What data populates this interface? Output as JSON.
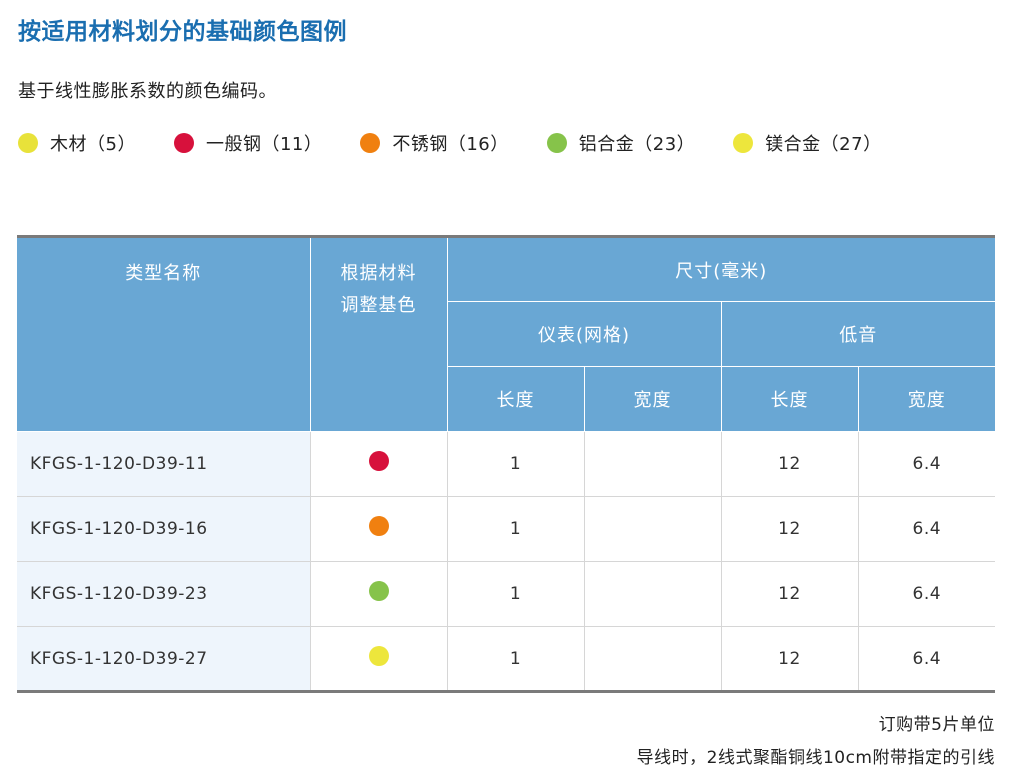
{
  "title": "按适用材料划分的基础颜色图例",
  "subtitle": "基于线性膨胀系数的颜色编码。",
  "legend": [
    {
      "label": "木材（5）",
      "color": "#e8e23a"
    },
    {
      "label": "一般钢（11）",
      "color": "#d7113c"
    },
    {
      "label": "不锈钢（16）",
      "color": "#f08010"
    },
    {
      "label": "铝合金（23）",
      "color": "#86c34a"
    },
    {
      "label": "镁合金（27）",
      "color": "#ede63c"
    }
  ],
  "table": {
    "headers": {
      "type_name": "类型名称",
      "base_color_line1": "根据材料",
      "base_color_line2": "调整基色",
      "size": "尺寸(毫米)",
      "gauge": "仪表(网格)",
      "bass": "低音",
      "length": "长度",
      "width": "宽度"
    },
    "rows": [
      {
        "name": "KFGS-1-120-D39-11",
        "color": "#d7113c",
        "gauge_length": "1",
        "gauge_width": "",
        "bass_length": "12",
        "bass_width": "6.4"
      },
      {
        "name": "KFGS-1-120-D39-16",
        "color": "#f08010",
        "gauge_length": "1",
        "gauge_width": "",
        "bass_length": "12",
        "bass_width": "6.4"
      },
      {
        "name": "KFGS-1-120-D39-23",
        "color": "#86c34a",
        "gauge_length": "1",
        "gauge_width": "",
        "bass_length": "12",
        "bass_width": "6.4"
      },
      {
        "name": "KFGS-1-120-D39-27",
        "color": "#ede63c",
        "gauge_length": "1",
        "gauge_width": "",
        "bass_length": "12",
        "bass_width": "6.4"
      }
    ]
  },
  "notes": {
    "line1": "订购带5片单位",
    "line2": "导线时，2线式聚酯铜线10cm附带指定的引线"
  }
}
